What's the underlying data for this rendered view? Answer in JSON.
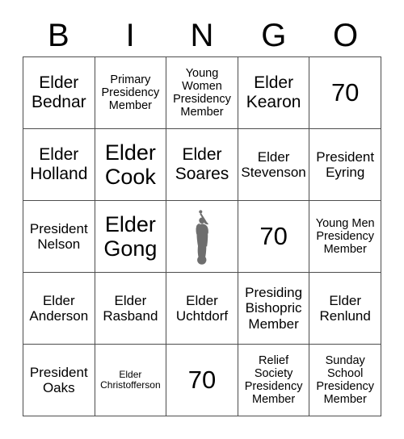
{
  "card": {
    "title": "BINGO",
    "headers": [
      "B",
      "I",
      "N",
      "G",
      "O"
    ],
    "free_space": {
      "icon": "angel-moroni-statue-icon",
      "color": "#6e6e6e"
    },
    "border_color": "#4d4d4d",
    "rows": [
      [
        {
          "text": "Elder Bednar",
          "size": "lg"
        },
        {
          "text": "Primary Presidency Member",
          "size": "sm"
        },
        {
          "text": "Young Women Presidency Member",
          "size": "sm"
        },
        {
          "text": "Elder Kearon",
          "size": "lg"
        },
        {
          "text": "70",
          "size": "xxl"
        }
      ],
      [
        {
          "text": "Elder Holland",
          "size": "lg"
        },
        {
          "text": "Elder Cook",
          "size": "xl"
        },
        {
          "text": "Elder Soares",
          "size": "lg"
        },
        {
          "text": "Elder Stevenson",
          "size": "md"
        },
        {
          "text": "President Eyring",
          "size": "md"
        }
      ],
      [
        {
          "text": "President Nelson",
          "size": "md"
        },
        {
          "text": "Elder Gong",
          "size": "xl"
        },
        {
          "text": "",
          "size": "free"
        },
        {
          "text": "70",
          "size": "xxl"
        },
        {
          "text": "Young Men Presidency Member",
          "size": "sm"
        }
      ],
      [
        {
          "text": "Elder Anderson",
          "size": "md"
        },
        {
          "text": "Elder Rasband",
          "size": "md"
        },
        {
          "text": "Elder Uchtdorf",
          "size": "md"
        },
        {
          "text": "Presiding Bishopric Member",
          "size": "md"
        },
        {
          "text": "Elder Renlund",
          "size": "md"
        }
      ],
      [
        {
          "text": "President Oaks",
          "size": "md"
        },
        {
          "text": "Elder Christofferson",
          "size": "xs"
        },
        {
          "text": "70",
          "size": "xxl"
        },
        {
          "text": "Relief Society Presidency Member",
          "size": "sm"
        },
        {
          "text": "Sunday School Presidency Member",
          "size": "sm"
        }
      ]
    ]
  }
}
